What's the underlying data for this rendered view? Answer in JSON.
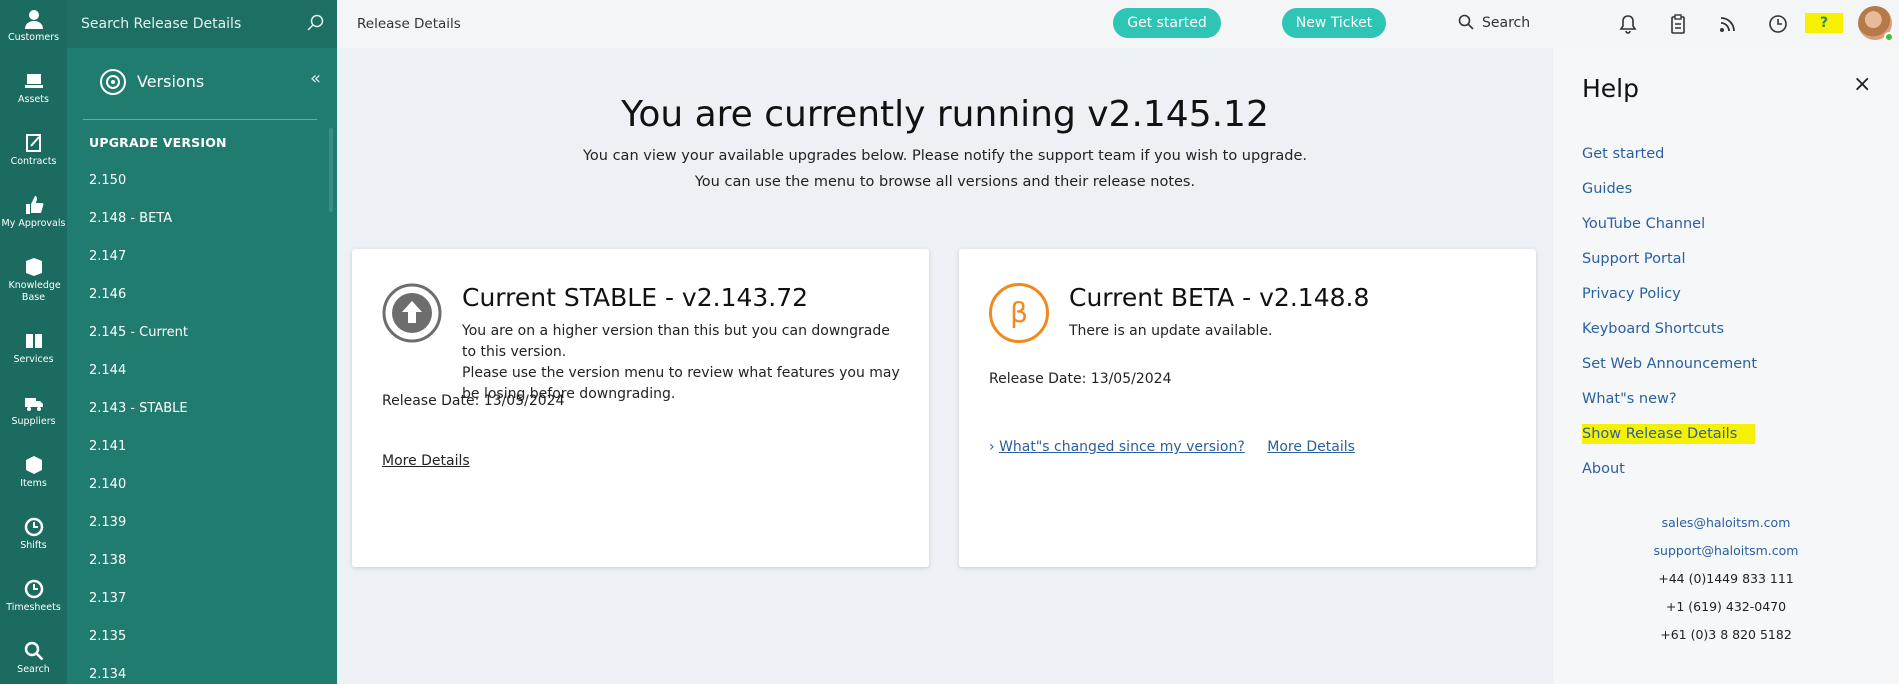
{
  "rail": {
    "items": [
      {
        "label": "Customers",
        "icon": "person-icon"
      },
      {
        "label": "Assets",
        "icon": "laptop-icon"
      },
      {
        "label": "Contracts",
        "icon": "contract-icon"
      },
      {
        "label": "My Approvals",
        "icon": "thumbs-up-icon"
      },
      {
        "label": "Knowledge Base",
        "icon": "knowledge-base-icon"
      },
      {
        "label": "Services",
        "icon": "book-icon"
      },
      {
        "label": "Suppliers",
        "icon": "truck-icon"
      },
      {
        "label": "Items",
        "icon": "box-icon"
      },
      {
        "label": "Shifts",
        "icon": "clock-icon"
      },
      {
        "label": "Timesheets",
        "icon": "clock-icon"
      },
      {
        "label": "Search",
        "icon": "search-icon"
      }
    ]
  },
  "versions": {
    "search_placeholder": "Search Release Details",
    "title": "Versions",
    "collapse": "«",
    "items": [
      {
        "label": "UPGRADE VERSION",
        "header": true
      },
      {
        "label": "2.150"
      },
      {
        "label": "2.148 - BETA"
      },
      {
        "label": "2.147"
      },
      {
        "label": "2.146"
      },
      {
        "label": "2.145 - Current"
      },
      {
        "label": "2.144"
      },
      {
        "label": "2.143 - STABLE"
      },
      {
        "label": "2.141"
      },
      {
        "label": "2.140"
      },
      {
        "label": "2.139"
      },
      {
        "label": "2.138"
      },
      {
        "label": "2.137"
      },
      {
        "label": "2.135"
      },
      {
        "label": "2.134"
      }
    ]
  },
  "topbar": {
    "breadcrumb": "Release Details",
    "get_started": "Get started",
    "new_ticket": "New Ticket",
    "search": "Search",
    "help_glyph": "?"
  },
  "main": {
    "heading": "You are currently running v2.145.12",
    "sub1": "You can view your available upgrades below. Please notify the support team if you wish to upgrade.",
    "sub2": "You can use the menu to browse all versions and their release notes.",
    "stable": {
      "title": "Current STABLE - v2.143.72",
      "desc1": "You are on a higher version than this but you can downgrade to this version.",
      "desc2": "Please use the version menu to review what features you may be losing before downgrading.",
      "release_date": "Release Date: 13/05/2024",
      "more": "More Details"
    },
    "beta": {
      "badge": "β",
      "title": "Current BETA - v2.148.8",
      "desc": "There is an update available.",
      "release_date": "Release Date: 13/05/2024",
      "changed": "What\"s changed since my version?",
      "more": "More Details"
    }
  },
  "help": {
    "title": "Help",
    "close": "×",
    "links": [
      {
        "label": "Get started"
      },
      {
        "label": "Guides"
      },
      {
        "label": "YouTube Channel"
      },
      {
        "label": "Support Portal"
      },
      {
        "label": "Privacy Policy"
      },
      {
        "label": "Keyboard Shortcuts"
      },
      {
        "label": "Set Web Announcement"
      },
      {
        "label": "What\"s new?"
      },
      {
        "label": "Show Release Details",
        "highlight": true
      },
      {
        "label": "About"
      }
    ],
    "email_sales": "sales@haloitsm.com",
    "email_support": "support@haloitsm.com",
    "phones": [
      "+44 (0)1449 833 111",
      "+1 (619) 432-0470",
      "+61 (0)3 8 820 5182"
    ]
  },
  "colors": {
    "rail": "#1b6b60",
    "panel": "#217c70",
    "accent": "#2ec4b6",
    "stable_badge": "#6d6d6d",
    "beta_badge": "#f08a1c",
    "link": "#2a5fa0",
    "highlight": "#f6f100"
  }
}
